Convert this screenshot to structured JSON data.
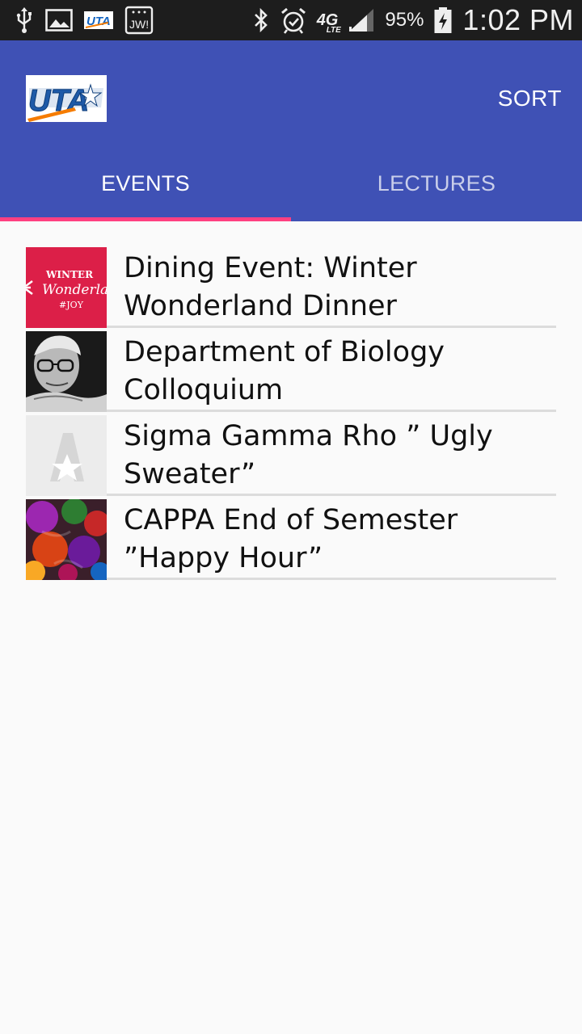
{
  "status_bar": {
    "icons_left": [
      "usb-icon",
      "image-icon",
      "uta-app-icon",
      "jw-icon"
    ],
    "icons_right": [
      "bluetooth-icon",
      "alarm-icon",
      "network-4g-lte-icon",
      "signal-icon",
      "battery-charging-icon"
    ],
    "network_label": "4G",
    "network_sub": "LTE",
    "battery_percent": "95%",
    "time": "1:02 PM"
  },
  "app_bar": {
    "color": "#3f51b5",
    "logo_text": "UTA",
    "sort_label": "SORT"
  },
  "tabs": [
    {
      "label": "EVENTS",
      "selected": true
    },
    {
      "label": "LECTURES",
      "selected": false
    }
  ],
  "indicator_color": "#ff4081",
  "events": [
    {
      "title": "Dining Event: Winter Wonderland Dinner",
      "thumb": "winter-wonderland-image",
      "thumb_lines": [
        "WINTER",
        "Wonderland",
        "#JOY"
      ]
    },
    {
      "title": "Department of Biology Colloquium",
      "thumb": "portrait-photo"
    },
    {
      "title": "Sigma Gamma Rho ” Ugly Sweater”",
      "thumb": "uta-placeholder-logo"
    },
    {
      "title": "CAPPA End of Semester ”Happy Hour”",
      "thumb": "ornaments-photo"
    }
  ]
}
